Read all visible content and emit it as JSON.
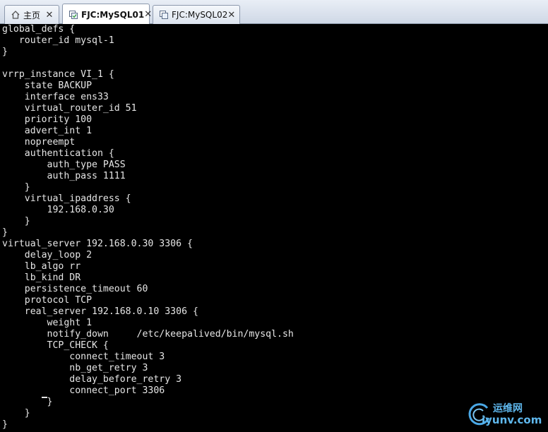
{
  "tabs": [
    {
      "label": "主页",
      "icon": "home-icon",
      "active": false
    },
    {
      "label": "FJC:MySQL01",
      "icon": "vm-icon",
      "active": true
    },
    {
      "label": "FJC:MySQL02",
      "icon": "vm-icon",
      "active": false
    }
  ],
  "terminal": {
    "lines": [
      "global_defs {",
      "   router_id mysql-1",
      "}",
      "",
      "vrrp_instance VI_1 {",
      "    state BACKUP",
      "    interface ens33",
      "    virtual_router_id 51",
      "    priority 100",
      "    advert_int 1",
      "    nopreempt",
      "    authentication {",
      "        auth_type PASS",
      "        auth_pass 1111",
      "    }",
      "    virtual_ipaddress {",
      "        192.168.0.30",
      "    }",
      "}",
      "virtual_server 192.168.0.30 3306 {",
      "    delay_loop 2",
      "    lb_algo rr",
      "    lb_kind DR",
      "    persistence_timeout 60",
      "    protocol TCP",
      "    real_server 192.168.0.10 3306 {",
      "        weight 1",
      "        notify_down     /etc/keepalived/bin/mysql.sh",
      "        TCP_CHECK {",
      "            connect_timeout 3",
      "            nb_get_retry 3",
      "            delay_before_retry 3",
      "            connect_port 3306",
      "        }",
      "    }",
      "}"
    ]
  },
  "watermark": {
    "top": "运维网",
    "bottom": "iyunv.com"
  }
}
